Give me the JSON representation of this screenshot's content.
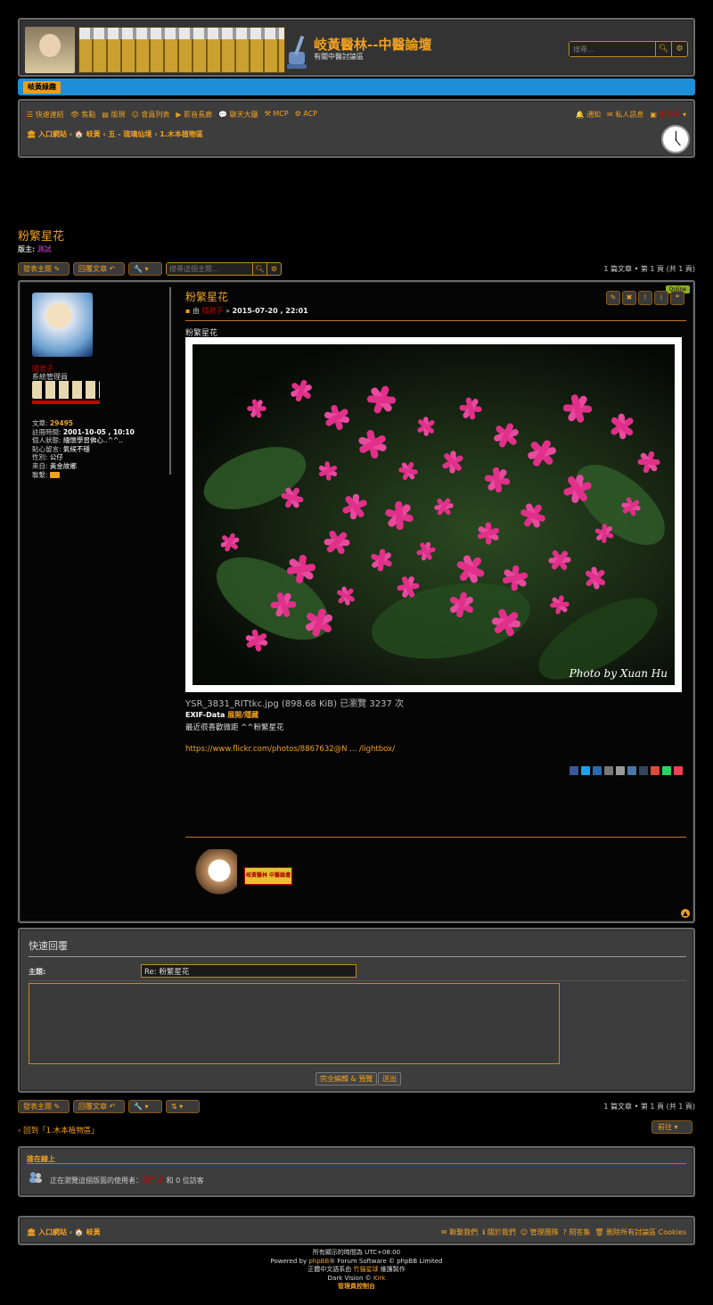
{
  "header": {
    "title": "岐黃醫林--中醫論壇",
    "description": "有關中醫討論區",
    "search_placeholder": "搜尋…"
  },
  "tabbar": {
    "tab": "岐黃綠趣"
  },
  "nav": {
    "quick_links": "快速連結",
    "hot": "焦點",
    "rules": "版規",
    "members": "會員列表",
    "video": "影音長廊",
    "chat": "聊天大廳",
    "mcp": "MCP",
    "acp": "ACP",
    "notifications": "通知",
    "pm": "私人訊息",
    "user": "隱君子"
  },
  "breadcrumb": {
    "portal": "入口網站",
    "home": "岐黃",
    "forum1": "五 - 琉璃仙境",
    "forum2": "1.木本植物區"
  },
  "topic": {
    "title": "粉繁星花",
    "moderator_label": "版主:",
    "moderator": "測試",
    "posts_count": "1 篇文章 • 第 1 頁 (共 1 頁)"
  },
  "actions": {
    "new_topic": "發表主題",
    "reply": "回覆文章",
    "tools": "🔧",
    "search_placeholder": "搜尋這個主題…"
  },
  "post": {
    "author": "隱君子",
    "rank": "系統管理員",
    "posts_label": "文章:",
    "posts": "29495",
    "joined_label": "註冊時間:",
    "joined": "2001-10-05 , 10:10",
    "sig_label": "個人狀態:",
    "sig": "緬懷學習佛心..^^..",
    "mood_label": "貼心留言:",
    "mood": "氣候不穩",
    "gender_label": "性別:",
    "gender": "公仔",
    "from_label": "來自:",
    "from": "黃金故鄉",
    "contact_label": "聯繫:",
    "subject": "粉繁星花",
    "by": "由",
    "date": "2015-07-20 , 22:01",
    "online": "Online",
    "body_title": "粉繁星花",
    "file": "YSR_3831_RITtkc.jpg (898.68 KiB) 已瀏覽 3237 次",
    "exif_label": "EXIF-Data",
    "exif_toggle": "展開/隱藏",
    "desc": "最近很喜歡微距 ^^粉繁星花",
    "link": "https://www.flickr.com/photos/8867632@N ... /lightbox/",
    "photo_credit": "Photo by Xuan Hu",
    "sig_badge": "岐黃醫林 中醫論壇"
  },
  "quick_reply": {
    "title": "快速回覆",
    "subject_label": "主題:",
    "subject_value": "Re: 粉繁星花",
    "full_editor": "完全編輯 & 預覽",
    "submit": "送出"
  },
  "bottom": {
    "back": "回到「1.木本植物區」",
    "jump": "前往"
  },
  "online": {
    "title": "誰在線上",
    "text_pre": "正在瀏覽這個版面的使用者：",
    "user": "隱君子",
    "text_post": "和 0 位訪客"
  },
  "footer": {
    "portal": "入口網站",
    "home": "岐黃",
    "contact": "聯繫我們",
    "about": "關於我們",
    "team": "管理團隊",
    "faq": "問答集",
    "delete_cookies": "刪除所有討論區 Cookies",
    "timezone": "所有顯示的時間為 UTC+08:00",
    "powered_pre": "Powered by",
    "phpbb": "phpBB",
    "powered_post": "® Forum Software © phpBB Limited",
    "trans_pre": "正體中文語系由",
    "trans_name": "竹貓星球",
    "trans_post": "維護製作",
    "style_pre": "Dark Vision ©",
    "style_author": "Kirk",
    "admin": "管理員控制台"
  },
  "colors": {
    "accent": "#f0a020",
    "bluebar": "#1e8fd6",
    "user_red": "#cc0000"
  }
}
